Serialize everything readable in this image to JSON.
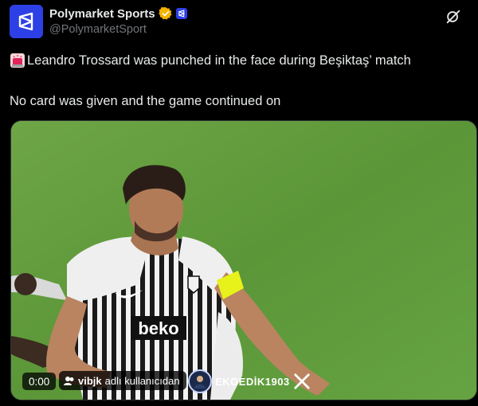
{
  "author": {
    "name": "Polymarket Sports",
    "handle": "@PolymarketSport",
    "avatar_icon": "polymarket-logo-icon",
    "verified_icon": "gold-verified-badge-icon",
    "affiliate_icon": "affiliate-badge-icon",
    "brand_color": "#2d40e6"
  },
  "header": {
    "grok_icon": "grok-icon"
  },
  "tweet": {
    "line1_icon": "siren-icon",
    "line1": "Leandro Trossard was punched in the face during Beşiktaş’ match",
    "line2": "No card was given and the game continued on"
  },
  "media": {
    "time": "0:00",
    "credit_user": "vibjk",
    "credit_suffix": "adlı kullanıcıdan",
    "watermark_text": "EKGEDİK1903",
    "watermark_icon": "x-logo-icon",
    "shirt_text": "beko",
    "pitch_color": "#5f9a3a"
  }
}
